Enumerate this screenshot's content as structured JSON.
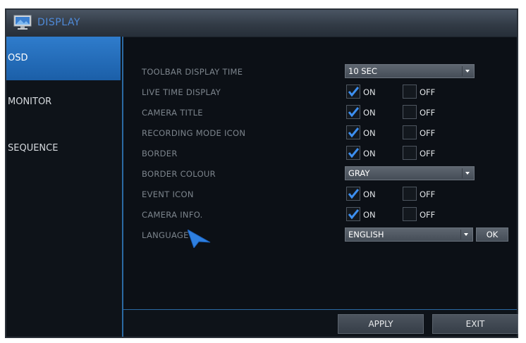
{
  "window": {
    "title": "DISPLAY",
    "icon": "monitor-icon"
  },
  "sidebar": {
    "items": [
      {
        "label": "OSD",
        "active": true
      },
      {
        "label": "MONITOR",
        "active": false
      },
      {
        "label": "SEQUENCE",
        "active": false
      }
    ]
  },
  "settings": {
    "toolbar_display_time": {
      "label": "TOOLBAR DISPLAY TIME",
      "value": "10 SEC"
    },
    "live_time_display": {
      "label": "LIVE TIME DISPLAY",
      "on_label": "ON",
      "off_label": "OFF",
      "value": "ON"
    },
    "camera_title": {
      "label": "CAMERA TITLE",
      "on_label": "ON",
      "off_label": "OFF",
      "value": "ON"
    },
    "recording_mode_icon": {
      "label": "RECORDING MODE ICON",
      "on_label": "ON",
      "off_label": "OFF",
      "value": "ON"
    },
    "border": {
      "label": "BORDER",
      "on_label": "ON",
      "off_label": "OFF",
      "value": "ON"
    },
    "border_colour": {
      "label": "BORDER COLOUR",
      "value": "GRAY"
    },
    "event_icon": {
      "label": "EVENT ICON",
      "on_label": "ON",
      "off_label": "OFF",
      "value": "ON"
    },
    "camera_info": {
      "label": "CAMERA INFO.",
      "on_label": "ON",
      "off_label": "OFF",
      "value": "ON"
    },
    "language": {
      "label": "LANGUAGE",
      "value": "ENGLISH",
      "ok_label": "OK"
    }
  },
  "footer": {
    "apply_label": "APPLY",
    "exit_label": "EXIT"
  },
  "colors": {
    "accent": "#2f7ccc",
    "check": "#3d8ff0",
    "title_text": "#4f8ad8"
  }
}
